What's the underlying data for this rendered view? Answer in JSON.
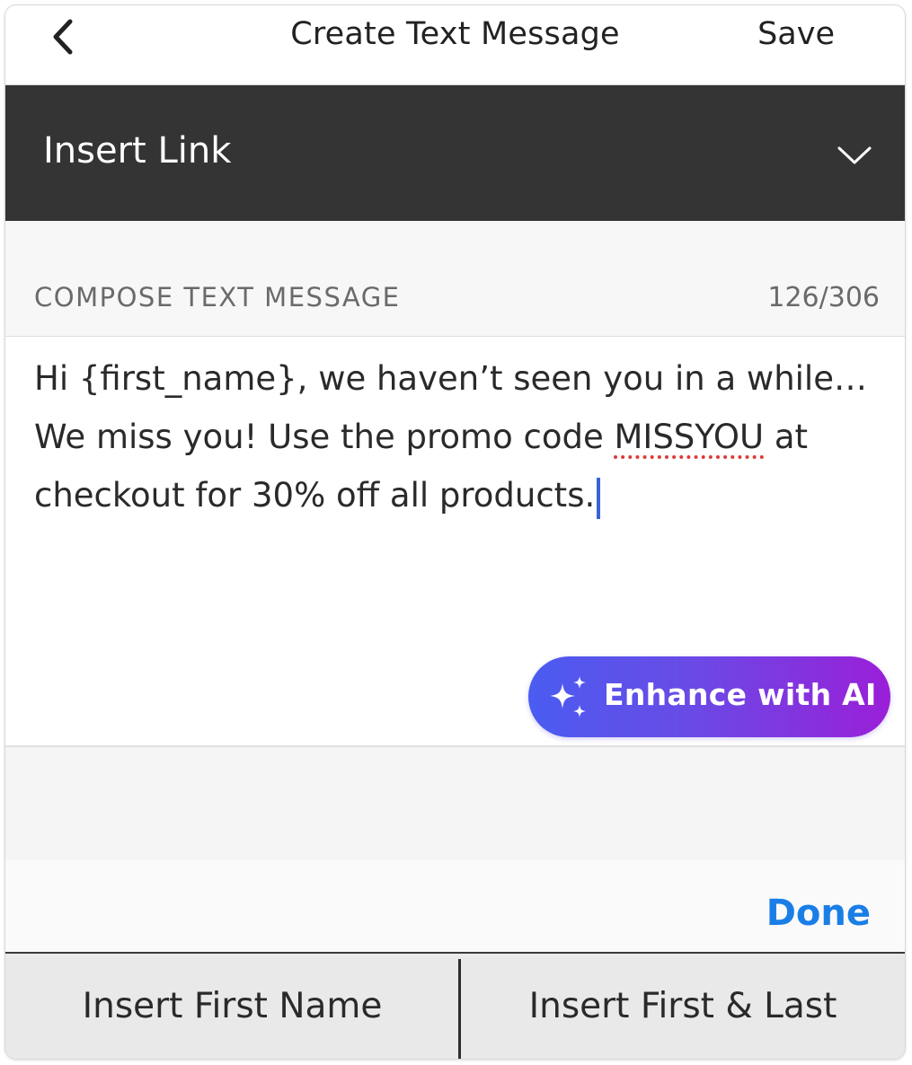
{
  "nav": {
    "back_icon": "chevron-left-icon",
    "title": "Create Text Message",
    "save_label": "Save"
  },
  "insert_link": {
    "label": "Insert Link",
    "chevron_icon": "chevron-down-icon"
  },
  "compose": {
    "label": "COMPOSE TEXT MESSAGE",
    "char_count": "126/306",
    "message_part1": "Hi {first_name}, we haven’t seen you in a while… We miss you! Use the promo code ",
    "message_flagged_word": "MISSYOU",
    "message_part2": " at checkout for 30% off all products."
  },
  "enhance": {
    "label": "Enhance with AI",
    "icon": "sparkles-icon",
    "gradient_start": "#4a5cf0",
    "gradient_end": "#9a1fd8"
  },
  "accessory": {
    "done_label": "Done",
    "done_color": "#1a7ee6"
  },
  "insert_bar": {
    "first_name_label": "Insert First Name",
    "first_last_label": "Insert First & Last"
  },
  "colors": {
    "header_dark": "#343434",
    "caret": "#3a63d8",
    "spellcheck_underline": "#e03a3a"
  }
}
